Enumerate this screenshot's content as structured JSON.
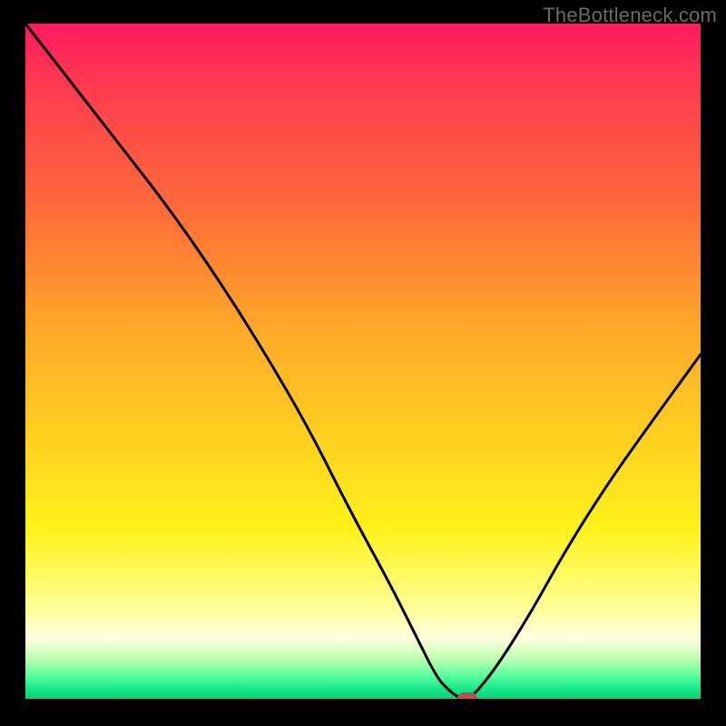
{
  "watermark": "TheBottleneck.com",
  "chart_data": {
    "type": "line",
    "title": "",
    "xlabel": "",
    "ylabel": "",
    "xlim": [
      0,
      100
    ],
    "ylim": [
      0,
      100
    ],
    "grid": false,
    "legend": false,
    "series": [
      {
        "name": "bottleneck-curve",
        "x": [
          0,
          7,
          14,
          21,
          28,
          35,
          42,
          48,
          54,
          58,
          61,
          63,
          64.5,
          66,
          70,
          75,
          80,
          86,
          92,
          100
        ],
        "y": [
          100,
          91,
          82,
          73,
          63,
          52,
          40,
          28,
          17,
          9,
          3,
          1,
          0,
          0,
          5,
          13,
          22,
          31.5,
          40,
          51
        ]
      }
    ],
    "marker": {
      "name": "optimal-point",
      "x": 65.5,
      "y": 0,
      "color": "#c64a4d"
    },
    "background_gradient": {
      "type": "vertical",
      "stops": [
        {
          "pos": 0.0,
          "color": "#ff1a62"
        },
        {
          "pos": 0.09,
          "color": "#ff3a4f"
        },
        {
          "pos": 0.27,
          "color": "#ff6a3a"
        },
        {
          "pos": 0.45,
          "color": "#ffa829"
        },
        {
          "pos": 0.62,
          "color": "#ffd21f"
        },
        {
          "pos": 0.75,
          "color": "#fff21a"
        },
        {
          "pos": 0.86,
          "color": "#ffff8f"
        },
        {
          "pos": 0.91,
          "color": "#ffffe0"
        },
        {
          "pos": 0.94,
          "color": "#bfffb0"
        },
        {
          "pos": 0.965,
          "color": "#5affa0"
        },
        {
          "pos": 0.985,
          "color": "#18e888"
        },
        {
          "pos": 1.0,
          "color": "#03d472"
        }
      ]
    }
  }
}
